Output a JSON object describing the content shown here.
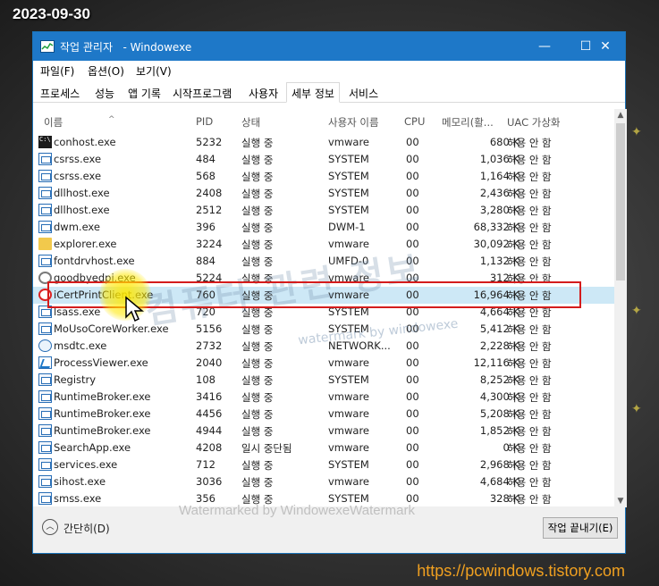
{
  "stamp": {
    "date": "2023-09-30",
    "url": "https://pcwindows.tistory.com"
  },
  "window": {
    "title": "작업 관리자",
    "title_suffix": "- Windowexe",
    "controls": {
      "minimize": "—",
      "maximize": "☐",
      "close": "✕"
    }
  },
  "menu": [
    "파일(F)",
    "옵션(O)",
    "보기(V)"
  ],
  "tabs": [
    "프로세스",
    "성능",
    "앱 기록",
    "시작프로그램",
    "사용자",
    "세부 정보",
    "서비스"
  ],
  "active_tab": "세부 정보",
  "columns": [
    "이름",
    "PID",
    "상태",
    "사용자 이름",
    "CPU",
    "메모리(활...",
    "UAC 가상화"
  ],
  "rows": [
    {
      "name": "conhost.exe",
      "pid": "5232",
      "status": "실행 중",
      "user": "vmware",
      "cpu": "00",
      "mem": "680 K",
      "uac": "허용 안 함",
      "icon": "console-icon"
    },
    {
      "name": "csrss.exe",
      "pid": "484",
      "status": "실행 중",
      "user": "SYSTEM",
      "cpu": "00",
      "mem": "1,036 K",
      "uac": "허용 안 함",
      "icon": "exe-icon"
    },
    {
      "name": "csrss.exe",
      "pid": "568",
      "status": "실행 중",
      "user": "SYSTEM",
      "cpu": "00",
      "mem": "1,164 K",
      "uac": "허용 안 함",
      "icon": "exe-icon"
    },
    {
      "name": "dllhost.exe",
      "pid": "2408",
      "status": "실행 중",
      "user": "SYSTEM",
      "cpu": "00",
      "mem": "2,436 K",
      "uac": "허용 안 함",
      "icon": "exe-icon"
    },
    {
      "name": "dllhost.exe",
      "pid": "2512",
      "status": "실행 중",
      "user": "SYSTEM",
      "cpu": "00",
      "mem": "3,280 K",
      "uac": "허용 안 함",
      "icon": "exe-icon"
    },
    {
      "name": "dwm.exe",
      "pid": "396",
      "status": "실행 중",
      "user": "DWM-1",
      "cpu": "00",
      "mem": "68,332 K",
      "uac": "허용 안 함",
      "icon": "exe-icon"
    },
    {
      "name": "explorer.exe",
      "pid": "3224",
      "status": "실행 중",
      "user": "vmware",
      "cpu": "00",
      "mem": "30,092 K",
      "uac": "허용 안 함",
      "icon": "folder-icon"
    },
    {
      "name": "fontdrvhost.exe",
      "pid": "884",
      "status": "실행 중",
      "user": "UMFD-0",
      "cpu": "00",
      "mem": "1,132 K",
      "uac": "허용 안 함",
      "icon": "exe-icon"
    },
    {
      "name": "goodbyedpi.exe",
      "pid": "5224",
      "status": "실행 중",
      "user": "vmware",
      "cpu": "00",
      "mem": "312 K",
      "uac": "허용 안 함",
      "icon": "gear-icon"
    },
    {
      "name": "iCertPrintClient.exe",
      "pid": "760",
      "status": "실행 중",
      "user": "vmware",
      "cpu": "00",
      "mem": "16,964 K",
      "uac": "허용 안 함",
      "icon": "red-circle-icon",
      "selected": true
    },
    {
      "name": "lsass.exe",
      "pid": "720",
      "status": "실행 중",
      "user": "SYSTEM",
      "cpu": "00",
      "mem": "4,664 K",
      "uac": "허용 안 함",
      "icon": "exe-icon"
    },
    {
      "name": "MoUsoCoreWorker.exe",
      "pid": "5156",
      "status": "실행 중",
      "user": "SYSTEM",
      "cpu": "00",
      "mem": "5,412 K",
      "uac": "허용 안 함",
      "icon": "exe-icon"
    },
    {
      "name": "msdtc.exe",
      "pid": "2732",
      "status": "실행 중",
      "user": "NETWORK...",
      "cpu": "00",
      "mem": "2,228 K",
      "uac": "허용 안 함",
      "icon": "network-icon"
    },
    {
      "name": "ProcessViewer.exe",
      "pid": "2040",
      "status": "실행 중",
      "user": "vmware",
      "cpu": "00",
      "mem": "12,116 K",
      "uac": "허용 안 함",
      "icon": "wave-icon"
    },
    {
      "name": "Registry",
      "pid": "108",
      "status": "실행 중",
      "user": "SYSTEM",
      "cpu": "00",
      "mem": "8,252 K",
      "uac": "허용 안 함",
      "icon": "exe-icon"
    },
    {
      "name": "RuntimeBroker.exe",
      "pid": "3416",
      "status": "실행 중",
      "user": "vmware",
      "cpu": "00",
      "mem": "4,300 K",
      "uac": "허용 안 함",
      "icon": "exe-icon"
    },
    {
      "name": "RuntimeBroker.exe",
      "pid": "4456",
      "status": "실행 중",
      "user": "vmware",
      "cpu": "00",
      "mem": "5,208 K",
      "uac": "허용 안 함",
      "icon": "exe-icon"
    },
    {
      "name": "RuntimeBroker.exe",
      "pid": "4944",
      "status": "실행 중",
      "user": "vmware",
      "cpu": "00",
      "mem": "1,852 K",
      "uac": "허용 안 함",
      "icon": "exe-icon"
    },
    {
      "name": "SearchApp.exe",
      "pid": "4208",
      "status": "일시 중단됨",
      "user": "vmware",
      "cpu": "00",
      "mem": "0 K",
      "uac": "허용 안 함",
      "icon": "exe-icon"
    },
    {
      "name": "services.exe",
      "pid": "712",
      "status": "실행 중",
      "user": "SYSTEM",
      "cpu": "00",
      "mem": "2,968 K",
      "uac": "허용 안 함",
      "icon": "exe-icon"
    },
    {
      "name": "sihost.exe",
      "pid": "3036",
      "status": "실행 중",
      "user": "vmware",
      "cpu": "00",
      "mem": "4,684 K",
      "uac": "허용 안 함",
      "icon": "exe-icon"
    },
    {
      "name": "smss.exe",
      "pid": "356",
      "status": "실행 중",
      "user": "SYSTEM",
      "cpu": "00",
      "mem": "328 K",
      "uac": "허용 안 함",
      "icon": "exe-icon"
    }
  ],
  "footer": {
    "collapse_label": "간단히(D)",
    "end_task_label": "작업 끝내기(E)"
  },
  "watermarks": {
    "footer": "Watermarked by WindowexeWatermark",
    "korean": "컴퓨터 관련 정보",
    "english": "watermark by windowexe"
  },
  "colors": {
    "titlebar": "#1e78c8",
    "selected_row": "#cde8f6",
    "highlight_box": "#d41c1c",
    "url": "#f0a020"
  }
}
